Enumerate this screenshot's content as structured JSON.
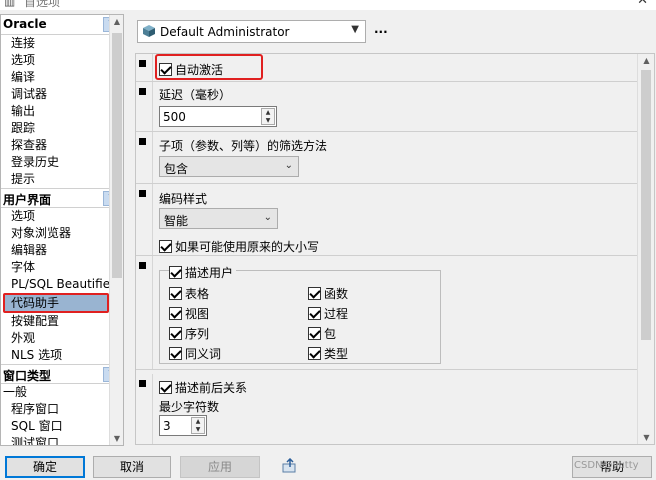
{
  "window": {
    "title": "首选项",
    "close_icon": "close-icon"
  },
  "colors": {
    "accent": "#0078d7",
    "selection": "#99b4d1",
    "highlight": "#e02020"
  },
  "tree": {
    "sections": [
      {
        "label": "Oracle",
        "items": [
          "连接",
          "选项",
          "编译",
          "调试器",
          "输出",
          "跟踪",
          "探查器",
          "登录历史",
          "提示"
        ]
      },
      {
        "label": "用户界面",
        "items": [
          "选项",
          "对象浏览器",
          "编辑器",
          "字体",
          "PL/SQL Beautifier",
          "代码助手",
          "按键配置",
          "外观",
          "NLS 选项"
        ],
        "selected": "代码助手"
      },
      {
        "label": "窗口类型",
        "items": [
          "一般",
          "程序窗口",
          "SQL 窗口",
          "测试窗口"
        ]
      }
    ]
  },
  "profile": {
    "value": "Default Administrator",
    "more": "..."
  },
  "options": {
    "auto_activate": "自动激活",
    "delay_label": "延迟（毫秒）",
    "delay_value": "500",
    "filter_label": "子项（参数、列等）的筛选方法",
    "filter_value": "包含",
    "case_label": "编码样式",
    "case_value": "智能",
    "use_original_case": "如果可能使用原来的大小写",
    "describe_users": "描述用户",
    "object_types": [
      "表格",
      "函数",
      "视图",
      "过程",
      "序列",
      "包",
      "同义词",
      "类型"
    ],
    "describe_context": "描述前后关系",
    "min_chars_label": "最少字符数",
    "min_chars_value": "3"
  },
  "buttons": {
    "ok": "确定",
    "cancel": "取消",
    "apply": "应用",
    "help": "帮助"
  },
  "watermark": "CSDN@yutty"
}
